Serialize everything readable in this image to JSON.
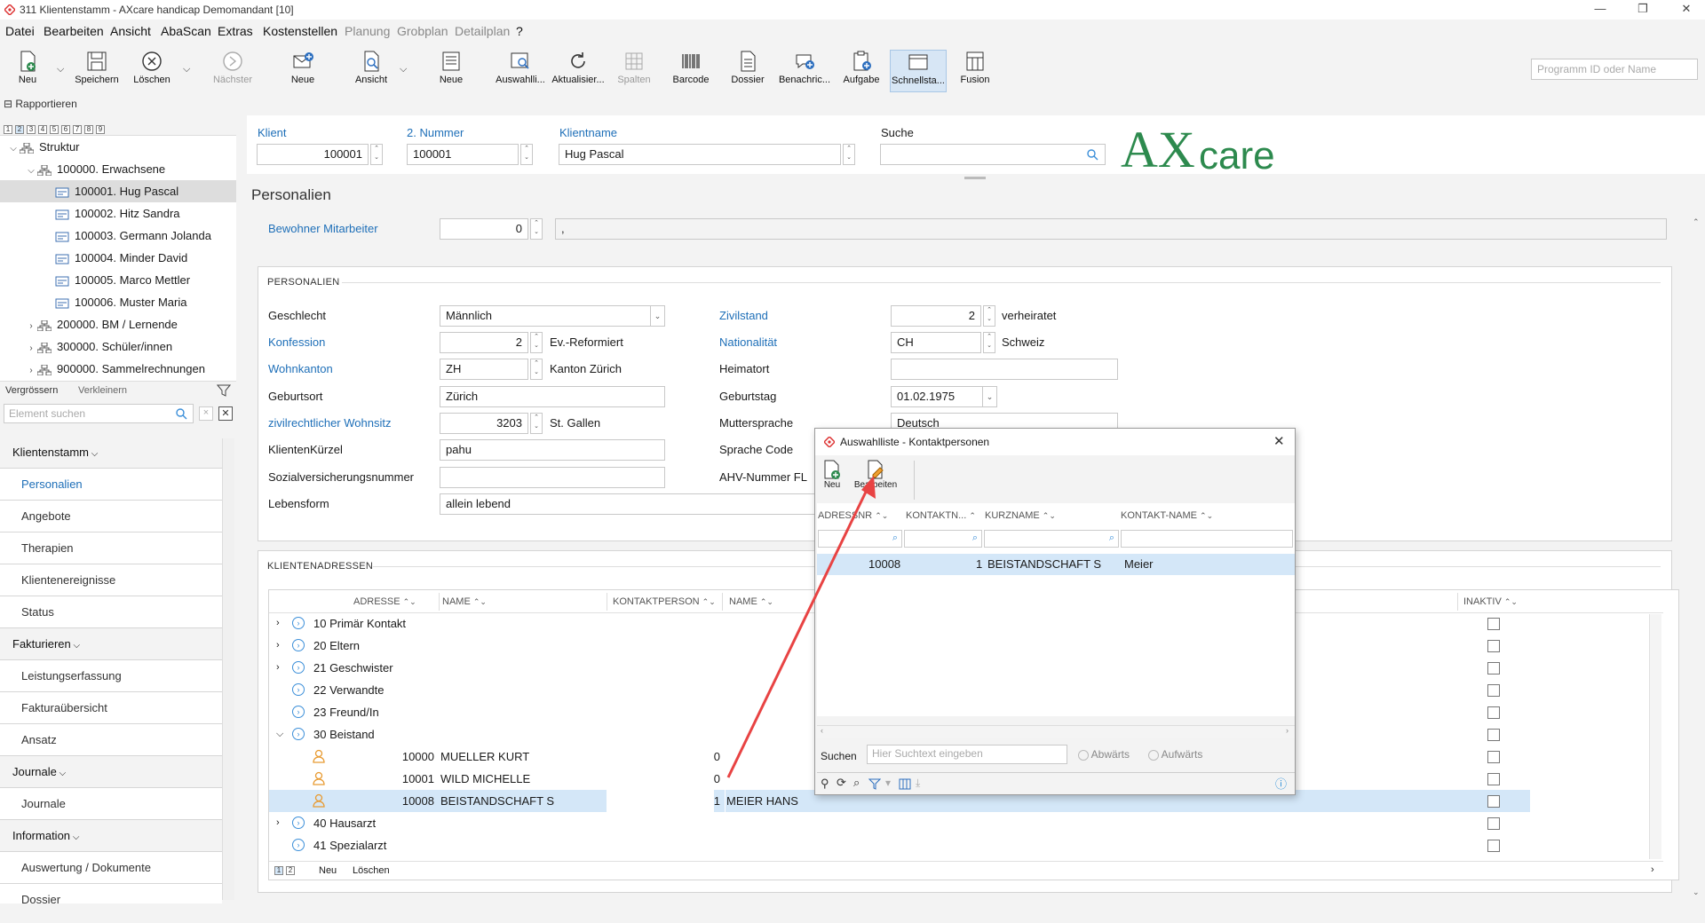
{
  "window": {
    "title": "311 Klientenstamm - AXcare handicap Demomandant [10]",
    "min": "—",
    "max": "❐",
    "close": "✕"
  },
  "menu": [
    {
      "label": "Datei",
      "enabled": true
    },
    {
      "label": "Bearbeiten",
      "enabled": true
    },
    {
      "label": "Ansicht",
      "enabled": true
    },
    {
      "label": "AbaScan",
      "enabled": true
    },
    {
      "label": "Extras",
      "enabled": true
    },
    {
      "label": "Kostenstellen",
      "enabled": true
    },
    {
      "label": "Planung",
      "enabled": false
    },
    {
      "label": "Grobplan",
      "enabled": false
    },
    {
      "label": "Detailplan",
      "enabled": false
    },
    {
      "label": "?",
      "enabled": true
    }
  ],
  "toolbar": {
    "neu": "Neu",
    "speichern": "Speichern",
    "loeschen": "Löschen",
    "naechster": "Nächster",
    "neue": "Neue",
    "ansicht": "Ansicht",
    "neu2": "Neue",
    "auswahlliste": "Auswahlli...",
    "aktualisieren": "Aktualisier...",
    "spalten": "Spalten",
    "barcode": "Barcode",
    "dossier": "Dossier",
    "benachrichtigung": "Benachric...",
    "aufgabe": "Aufgabe",
    "schnellstart": "Schnellsta...",
    "fusion": "Fusion",
    "program_search_placeholder": "Programm ID oder Name"
  },
  "left": {
    "rapportieren": "Rapportieren",
    "levels": [
      "1",
      "2",
      "3",
      "4",
      "5",
      "6",
      "7",
      "8",
      "9"
    ],
    "tree": [
      {
        "label": "Struktur",
        "level": 0,
        "expanded": true
      },
      {
        "label": "100000. Erwachsene",
        "level": 1,
        "expanded": true
      },
      {
        "label": "100001. Hug Pascal",
        "level": 2,
        "selected": true
      },
      {
        "label": "100002. Hitz Sandra",
        "level": 2
      },
      {
        "label": "100003. Germann Jolanda",
        "level": 2
      },
      {
        "label": "100004. Minder David",
        "level": 2
      },
      {
        "label": "100005. Marco Mettler",
        "level": 2
      },
      {
        "label": "100006. Muster Maria",
        "level": 2
      },
      {
        "label": "200000. BM / Lernende",
        "level": 1,
        "expanded": false
      },
      {
        "label": "300000. Schüler/innen",
        "level": 1,
        "expanded": false
      },
      {
        "label": "900000. Sammelrechnungen",
        "level": 1,
        "expanded": false
      }
    ],
    "vergroessern": "Vergrössern",
    "verkleinern": "Verkleinern",
    "element_search_placeholder": "Element suchen",
    "nav": [
      {
        "label": "Klientenstamm",
        "group": true
      },
      {
        "label": "Personalien",
        "active": true
      },
      {
        "label": "Angebote"
      },
      {
        "label": "Therapien"
      },
      {
        "label": "Klientenereignisse"
      },
      {
        "label": "Status"
      },
      {
        "label": "Fakturieren",
        "group": true
      },
      {
        "label": "Leistungserfassung"
      },
      {
        "label": "Fakturaübersicht"
      },
      {
        "label": "Ansatz"
      },
      {
        "label": "Journale",
        "group": true
      },
      {
        "label": "Journale"
      },
      {
        "label": "Information",
        "group": true
      },
      {
        "label": "Auswertung / Dokumente"
      },
      {
        "label": "Dossier"
      }
    ]
  },
  "header": {
    "klient_label": "Klient",
    "klient_value": "100001",
    "nummer2_label": "2. Nummer",
    "nummer2_value": "100001",
    "name_label": "Klientname",
    "name_value": "Hug Pascal",
    "suche_label": "Suche",
    "suche_value": "",
    "logo_ax": "AX",
    "logo_care": "care"
  },
  "section_title": "Personalien",
  "bewohner": {
    "label": "Bewohner Mitarbeiter",
    "value": "0",
    "text": ","
  },
  "personalien": {
    "title": "PERSONALIEN",
    "geschlecht_label": "Geschlecht",
    "geschlecht_value": "Männlich",
    "konfession_label": "Konfession",
    "konfession_value": "2",
    "konfession_text": "Ev.-Reformiert",
    "wohnkanton_label": "Wohnkanton",
    "wohnkanton_value": "ZH",
    "wohnkanton_text": "Kanton Zürich",
    "geburtsort_label": "Geburtsort",
    "geburtsort_value": "Zürich",
    "zwohnsitz_label": "zivilrechtlicher Wohnsitz",
    "zwohnsitz_value": "3203",
    "zwohnsitz_text": "St. Gallen",
    "kuerzel_label": "KlientenKürzel",
    "kuerzel_value": "pahu",
    "svn_label": "Sozialversicherungsnummer",
    "svn_value": "",
    "lebensform_label": "Lebensform",
    "lebensform_value": "allein lebend",
    "zivilstand_label": "Zivilstand",
    "zivilstand_value": "2",
    "zivilstand_text": "verheiratet",
    "nationalitaet_label": "Nationalität",
    "nationalitaet_value": "CH",
    "nationalitaet_text": "Schweiz",
    "heimatort_label": "Heimatort",
    "heimatort_value": "",
    "geburtstag_label": "Geburtstag",
    "geburtstag_value": "01.02.1975",
    "muttersprache_label": "Muttersprache",
    "muttersprache_value": "Deutsch",
    "sprachcode_label": "Sprache Code",
    "ahv_label": "AHV-Nummer FL"
  },
  "adressen": {
    "title": "KLIENTENADRESSEN",
    "columns": {
      "adresse": "ADRESSE",
      "name": "NAME",
      "kontaktperson": "KONTAKTPERSON",
      "name2": "NAME",
      "inaktiv": "INAKTIV"
    },
    "rows": [
      {
        "type": "group",
        "label": "10 Primär Kontakt",
        "expandable": true
      },
      {
        "type": "group",
        "label": "20 Eltern",
        "expandable": true
      },
      {
        "type": "group",
        "label": "21 Geschwister",
        "expandable": true
      },
      {
        "type": "group",
        "label": "22 Verwandte",
        "expandable": false
      },
      {
        "type": "group",
        "label": "23 Freund/In",
        "expandable": false
      },
      {
        "type": "group",
        "label": "30 Beistand",
        "expandable": true,
        "expanded": true
      },
      {
        "type": "person",
        "adresse": "10000",
        "name": "MUELLER KURT",
        "kontakt": "0",
        "name2": ""
      },
      {
        "type": "person",
        "adresse": "10001",
        "name": "WILD MICHELLE",
        "kontakt": "0",
        "name2": ""
      },
      {
        "type": "person",
        "adresse": "10008",
        "name": "BEISTANDSCHAFT S",
        "kontakt": "1",
        "name2": "MEIER HANS",
        "selected": true
      },
      {
        "type": "group",
        "label": "40 Hausarzt",
        "expandable": true
      },
      {
        "type": "group",
        "label": "41 Spezialarzt",
        "expandable": false
      }
    ],
    "footer": {
      "neu": "Neu",
      "loeschen": "Löschen",
      "pages": [
        "1",
        "2"
      ]
    }
  },
  "popup": {
    "title": "Auswahlliste - Kontaktpersonen",
    "neu": "Neu",
    "bearbeiten": "Bearbeiten",
    "columns": {
      "adressnr": "ADRESSNR",
      "kontaktnr": "KONTAKTN...",
      "kurzname": "KURZNAME",
      "kontaktname": "KONTAKT-NAME"
    },
    "rows": [
      {
        "adressnr": "10008",
        "kontaktnr": "1",
        "kurzname": "BEISTANDSCHAFT S",
        "kontaktname": "Meier"
      }
    ],
    "suchen_label": "Suchen",
    "suchen_placeholder": "Hier Suchtext eingeben",
    "abwaerts": "Abwärts",
    "aufwaerts": "Aufwärts"
  },
  "colors": {
    "accent": "#1e6fb8",
    "logo": "#2d8a4e",
    "arrow": "#e84343",
    "selection": "#d4e7f8"
  }
}
